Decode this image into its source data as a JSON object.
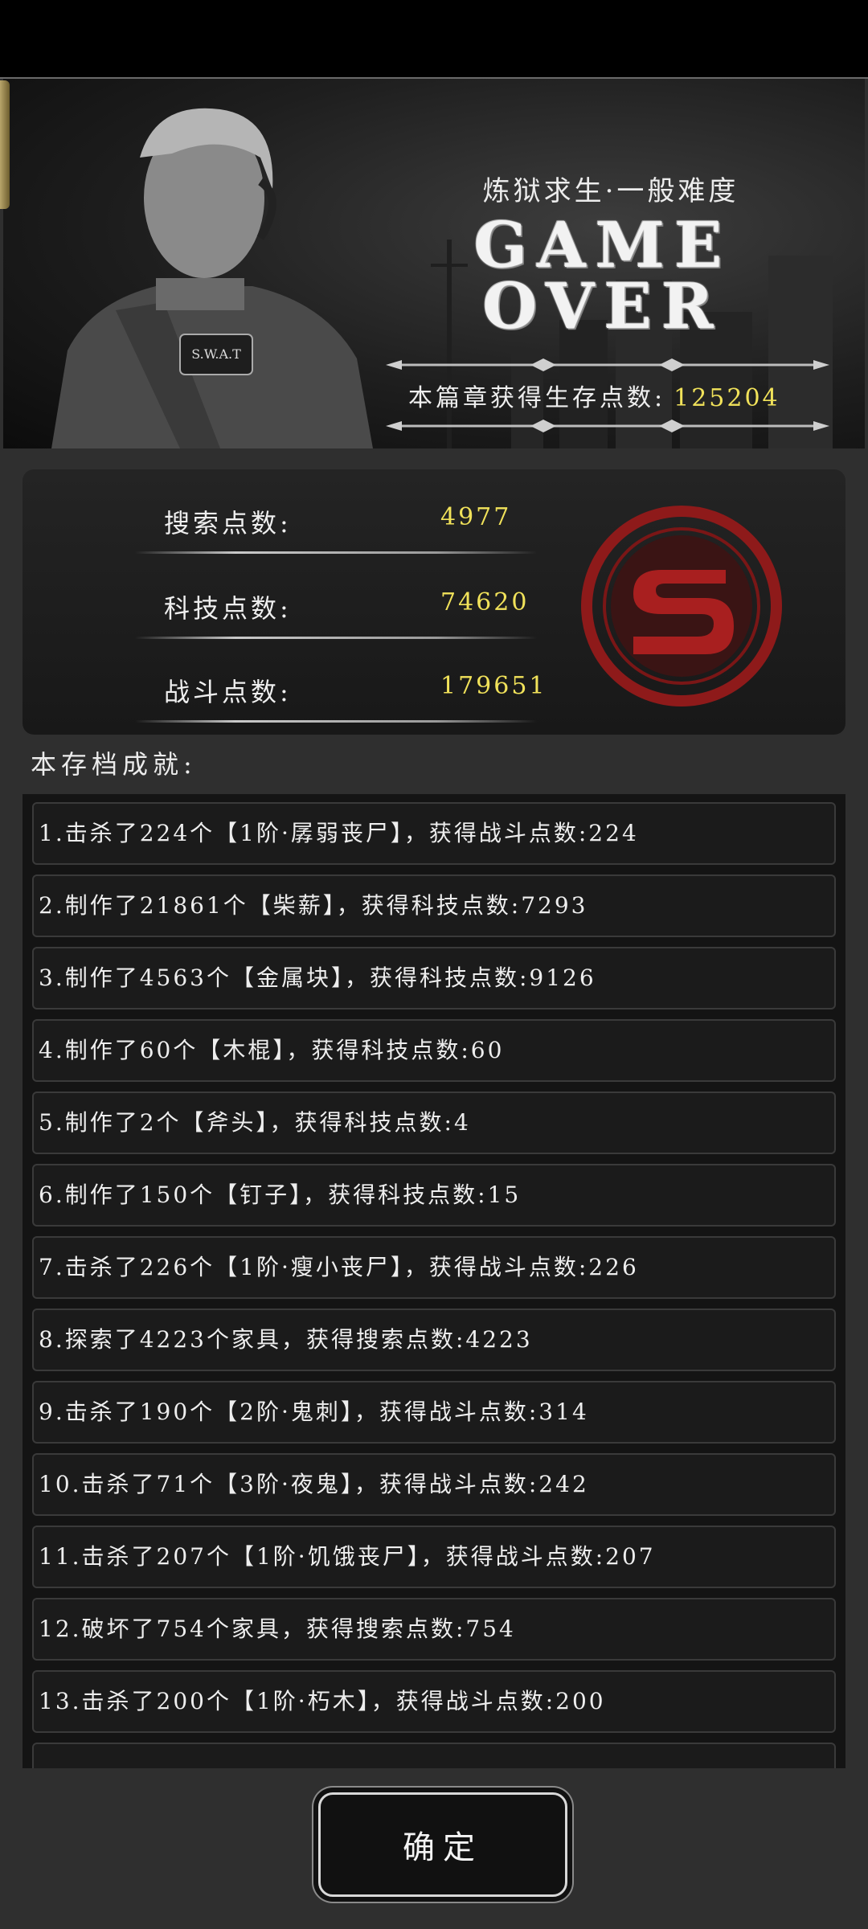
{
  "banner": {
    "difficulty": "炼狱求生·一般难度",
    "title_line1": "GAME",
    "title_line2": "OVER",
    "survival_label": "本篇章获得生存点数:",
    "survival_value": "125204",
    "badge_text": "S.W.A.T"
  },
  "stats": [
    {
      "label": "搜索点数:",
      "value": "4977"
    },
    {
      "label": "科技点数:",
      "value": "74620"
    },
    {
      "label": "战斗点数:",
      "value": "179651"
    }
  ],
  "achievements_title": "本存档成就:",
  "achievements": [
    "1.击杀了224个【1阶·孱弱丧尸】，获得战斗点数:224",
    "2.制作了21861个【柴薪】，获得科技点数:7293",
    "3.制作了4563个【金属块】，获得科技点数:9126",
    "4.制作了60个【木棍】，获得科技点数:60",
    "5.制作了2个【斧头】，获得科技点数:4",
    "6.制作了150个【钉子】，获得科技点数:15",
    "7.击杀了226个【1阶·瘦小丧尸】，获得战斗点数:226",
    "8.探索了4223个家具，获得搜索点数:4223",
    "9.击杀了190个【2阶·鬼刺】，获得战斗点数:314",
    "10.击杀了71个【3阶·夜鬼】，获得战斗点数:242",
    "11.击杀了207个【1阶·饥饿丧尸】，获得战斗点数:207",
    "12.破坏了754个家具，获得搜索点数:754",
    "13.击杀了200个【1阶·朽木】，获得战斗点数:200"
  ],
  "confirm_label": "确定",
  "colors": {
    "accent_yellow": "#f1e25a",
    "seal_red": "#9b1c1c"
  }
}
